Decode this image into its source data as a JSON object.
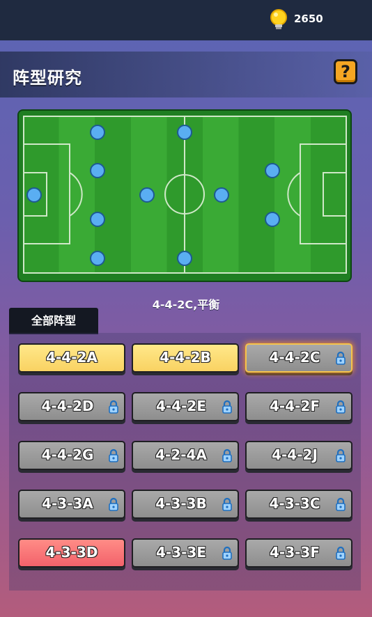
{
  "header": {
    "coin_count": "2650",
    "coin_icon": "lightbulb-icon"
  },
  "title": "阵型研究",
  "help_label": "?",
  "current_formation": "4-4-2C,平衡",
  "tab_label": "全部阵型",
  "colors": {
    "unlocked_yellow": "#f9d262",
    "locked_gray": "#9a9a9a",
    "special_red": "#f3626b",
    "player_blue": "#5aaef2"
  },
  "formations": [
    {
      "label": "4-4-2A",
      "state": "unlocked",
      "color": "yellow"
    },
    {
      "label": "4-4-2B",
      "state": "unlocked",
      "color": "yellow"
    },
    {
      "label": "4-4-2C",
      "state": "locked",
      "color": "gray",
      "selected": true
    },
    {
      "label": "4-4-2D",
      "state": "locked",
      "color": "gray"
    },
    {
      "label": "4-4-2E",
      "state": "locked",
      "color": "gray"
    },
    {
      "label": "4-4-2F",
      "state": "locked",
      "color": "gray"
    },
    {
      "label": "4-4-2G",
      "state": "locked",
      "color": "gray"
    },
    {
      "label": "4-2-4A",
      "state": "locked",
      "color": "gray"
    },
    {
      "label": "4-4-2J",
      "state": "locked",
      "color": "gray"
    },
    {
      "label": "4-3-3A",
      "state": "locked",
      "color": "gray"
    },
    {
      "label": "4-3-3B",
      "state": "locked",
      "color": "gray"
    },
    {
      "label": "4-3-3C",
      "state": "locked",
      "color": "gray"
    },
    {
      "label": "4-3-3D",
      "state": "unlocked",
      "color": "red"
    },
    {
      "label": "4-3-3E",
      "state": "locked",
      "color": "gray"
    },
    {
      "label": "4-3-3F",
      "state": "locked",
      "color": "gray"
    }
  ]
}
